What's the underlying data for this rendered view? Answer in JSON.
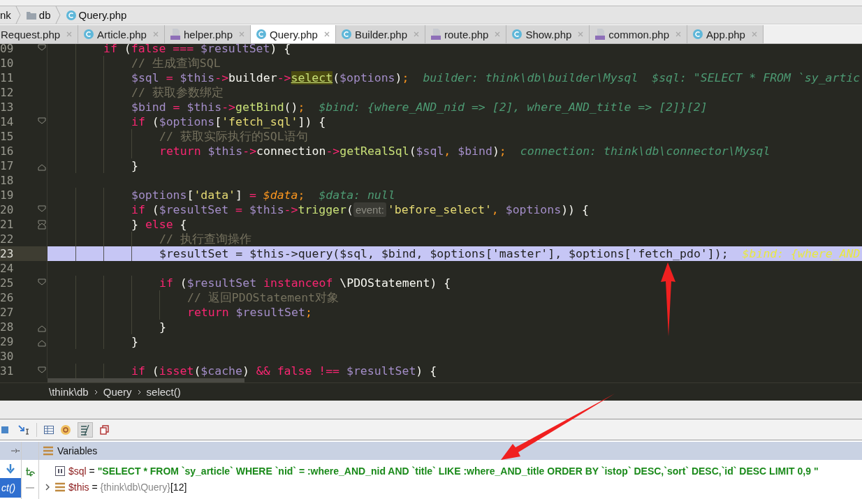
{
  "path_bar": [
    {
      "kind": "text",
      "label": "nk"
    },
    {
      "kind": "folder",
      "label": "db"
    },
    {
      "kind": "class",
      "label": "Query.php"
    }
  ],
  "tabs": [
    {
      "label": "Request.php",
      "kind": "plain",
      "selected": false
    },
    {
      "label": "Article.php",
      "kind": "class",
      "selected": false
    },
    {
      "label": "helper.php",
      "kind": "php",
      "selected": false
    },
    {
      "label": "Query.php",
      "kind": "class",
      "selected": true
    },
    {
      "label": "Builder.php",
      "kind": "class",
      "selected": false
    },
    {
      "label": "route.php",
      "kind": "php",
      "selected": false
    },
    {
      "label": "Show.php",
      "kind": "class",
      "selected": false
    },
    {
      "label": "common.php",
      "kind": "php",
      "selected": false
    },
    {
      "label": "App.php",
      "kind": "class",
      "selected": false
    }
  ],
  "lines": [
    {
      "number": "09",
      "fold_start": true,
      "fold_end": false,
      "current": false,
      "tokens": [
        {
          "kind": "kw",
          "text": "if"
        },
        {
          "kind": "txt",
          "text": " ("
        },
        {
          "kind": "kw",
          "text": "false === "
        },
        {
          "kind": "var",
          "text": "$resultSet"
        },
        {
          "kind": "txt",
          "text": ") {"
        }
      ],
      "children": [
        {
          "number": "10",
          "fold_start": false,
          "fold_end": false,
          "current": false,
          "tokens": [
            {
              "kind": "cmt",
              "text": "// 生成查询SQL"
            }
          ]
        },
        {
          "number": "11",
          "fold_start": false,
          "fold_end": false,
          "current": false,
          "tokens": [
            {
              "kind": "var",
              "text": "$sql"
            },
            {
              "kind": "op",
              "text": " = "
            },
            {
              "kind": "var",
              "text": "$this"
            },
            {
              "kind": "op",
              "text": "->"
            },
            {
              "kind": "txt",
              "text": "builder"
            },
            {
              "kind": "op",
              "text": "->"
            },
            {
              "kind": "usage",
              "text": "select"
            },
            {
              "kind": "txt",
              "text": "("
            },
            {
              "kind": "var",
              "text": "$options"
            },
            {
              "kind": "txt",
              "text": ")"
            },
            {
              "kind": "semi",
              "text": ";"
            },
            {
              "kind": "hint",
              "text": "builder: think\\db\\builder\\Mysql  $sql: \"SELECT * FROM `sy_artic"
            }
          ]
        },
        {
          "number": "12",
          "fold_start": false,
          "fold_end": false,
          "current": false,
          "tokens": [
            {
              "kind": "cmt",
              "text": "// 获取参数绑定"
            }
          ]
        },
        {
          "number": "13",
          "fold_start": false,
          "fold_end": false,
          "current": false,
          "tokens": [
            {
              "kind": "var",
              "text": "$bind"
            },
            {
              "kind": "op",
              "text": " = "
            },
            {
              "kind": "var",
              "text": "$this"
            },
            {
              "kind": "op",
              "text": "->"
            },
            {
              "kind": "fn",
              "text": "getBind"
            },
            {
              "kind": "txt",
              "text": "()"
            },
            {
              "kind": "semi",
              "text": ";"
            },
            {
              "kind": "hint",
              "text": "$bind: {where_AND_nid => [2], where_AND_title => [2]}[2]"
            }
          ]
        },
        {
          "number": "14",
          "fold_start": true,
          "fold_end": false,
          "current": false,
          "tokens": [
            {
              "kind": "kw",
              "text": "if"
            },
            {
              "kind": "txt",
              "text": " ("
            },
            {
              "kind": "var",
              "text": "$options"
            },
            {
              "kind": "txt",
              "text": "["
            },
            {
              "kind": "str",
              "text": "'fetch_sql'"
            },
            {
              "kind": "txt",
              "text": "]) {"
            }
          ],
          "children": [
            {
              "number": "15",
              "fold_start": false,
              "fold_end": false,
              "current": false,
              "tokens": [
                {
                  "kind": "cmt",
                  "text": "// 获取实际执行的SQL语句"
                }
              ]
            },
            {
              "number": "16",
              "fold_start": false,
              "fold_end": false,
              "current": false,
              "tokens": [
                {
                  "kind": "kw",
                  "text": "return "
                },
                {
                  "kind": "var",
                  "text": "$this"
                },
                {
                  "kind": "op",
                  "text": "->"
                },
                {
                  "kind": "txt",
                  "text": "connection"
                },
                {
                  "kind": "op",
                  "text": "->"
                },
                {
                  "kind": "fn",
                  "text": "getRealSql"
                },
                {
                  "kind": "txt",
                  "text": "("
                },
                {
                  "kind": "var",
                  "text": "$sql"
                },
                {
                  "kind": "semi",
                  "text": ", "
                },
                {
                  "kind": "var",
                  "text": "$bind"
                },
                {
                  "kind": "txt",
                  "text": ")"
                },
                {
                  "kind": "semi",
                  "text": ";"
                },
                {
                  "kind": "hint",
                  "text": "connection: think\\db\\connector\\Mysql"
                }
              ]
            }
          ]
        },
        {
          "number": "17",
          "fold_start": false,
          "fold_end": true,
          "current": false,
          "tokens": [
            {
              "kind": "txt",
              "text": "}"
            }
          ]
        },
        {
          "number": "18",
          "fold_start": false,
          "fold_end": false,
          "current": false
        },
        {
          "number": "19",
          "fold_start": false,
          "fold_end": false,
          "current": false,
          "tokens": [
            {
              "kind": "var",
              "text": "$options"
            },
            {
              "kind": "txt",
              "text": "["
            },
            {
              "kind": "str",
              "text": "'data'"
            },
            {
              "kind": "txt",
              "text": "]"
            },
            {
              "kind": "op",
              "text": " = "
            },
            {
              "kind": "param",
              "text": "$data"
            },
            {
              "kind": "semi",
              "text": ";"
            },
            {
              "kind": "hint",
              "text": "$data: null"
            }
          ]
        },
        {
          "number": "20",
          "fold_start": true,
          "fold_end": false,
          "current": false,
          "tokens": [
            {
              "kind": "kw",
              "text": "if"
            },
            {
              "kind": "txt",
              "text": " ("
            },
            {
              "kind": "var",
              "text": "$resultSet"
            },
            {
              "kind": "op",
              "text": " = "
            },
            {
              "kind": "var",
              "text": "$this"
            },
            {
              "kind": "op",
              "text": "->"
            },
            {
              "kind": "fn",
              "text": "trigger"
            },
            {
              "kind": "txt",
              "text": "("
            },
            {
              "kind": "label",
              "text": "event:"
            },
            {
              "kind": "str",
              "text": "'before_select'"
            },
            {
              "kind": "semi",
              "text": ", "
            },
            {
              "kind": "var",
              "text": "$options"
            },
            {
              "kind": "txt",
              "text": ")) {"
            }
          ]
        },
        {
          "number": "21",
          "fold_start": true,
          "fold_end": true,
          "current": false,
          "tokens": [
            {
              "kind": "txt",
              "text": "} "
            },
            {
              "kind": "kw",
              "text": "else"
            },
            {
              "kind": "txt",
              "text": " {"
            }
          ],
          "children": [
            {
              "number": "22",
              "fold_start": false,
              "fold_end": false,
              "current": false,
              "tokens": [
                {
                  "kind": "cmt",
                  "text": "// 执行查询操作"
                }
              ]
            },
            {
              "number": "23",
              "fold_start": false,
              "fold_end": false,
              "current": true,
              "tokens": [
                {
                  "kind": "txt",
                  "text": "$resultSet = $this->query($sql, $bind, $options['master'], $options['fetch_pdo']);"
                },
                {
                  "kind": "hint",
                  "text": "$bind: {where_AND"
                }
              ]
            },
            {
              "number": "24",
              "fold_start": false,
              "fold_end": false,
              "current": false
            },
            {
              "number": "25",
              "fold_start": true,
              "fold_end": false,
              "current": false,
              "tokens": [
                {
                  "kind": "kw",
                  "text": "if"
                },
                {
                  "kind": "txt",
                  "text": " ("
                },
                {
                  "kind": "var",
                  "text": "$resultSet"
                },
                {
                  "kind": "kw",
                  "text": " instanceof"
                },
                {
                  "kind": "txt",
                  "text": " \\PDOStatement) {"
                }
              ],
              "children": [
                {
                  "number": "26",
                  "fold_start": false,
                  "fold_end": false,
                  "current": false,
                  "tokens": [
                    {
                      "kind": "cmt",
                      "text": "// 返回PDOStatement对象"
                    }
                  ]
                },
                {
                  "number": "27",
                  "fold_start": false,
                  "fold_end": false,
                  "current": false,
                  "tokens": [
                    {
                      "kind": "kw",
                      "text": "return "
                    },
                    {
                      "kind": "var",
                      "text": "$resultSet"
                    },
                    {
                      "kind": "semi",
                      "text": ";"
                    }
                  ]
                }
              ]
            },
            {
              "number": "28",
              "fold_start": false,
              "fold_end": true,
              "current": false,
              "tokens": [
                {
                  "kind": "txt",
                  "text": "}"
                }
              ]
            }
          ]
        },
        {
          "number": "29",
          "fold_start": false,
          "fold_end": true,
          "current": false,
          "tokens": [
            {
              "kind": "txt",
              "text": "}"
            }
          ]
        },
        {
          "number": "30",
          "fold_start": false,
          "fold_end": false,
          "current": false
        },
        {
          "number": "31",
          "fold_start": true,
          "fold_end": false,
          "current": false,
          "tokens": [
            {
              "kind": "kw",
              "text": "if"
            },
            {
              "kind": "txt",
              "text": " ("
            },
            {
              "kind": "kw",
              "text": "isset"
            },
            {
              "kind": "txt",
              "text": "("
            },
            {
              "kind": "var",
              "text": "$cache"
            },
            {
              "kind": "txt",
              "text": ") "
            },
            {
              "kind": "kw",
              "text": "&& false !== "
            },
            {
              "kind": "var",
              "text": "$resultSet"
            },
            {
              "kind": "txt",
              "text": ") {"
            }
          ]
        }
      ]
    }
  ],
  "breadcrumb": [
    "\\think\\db",
    "Query",
    "select()"
  ],
  "debugger": {
    "frame": {
      "label": "ct()",
      "selected": true
    },
    "variables_title": "Variables",
    "variables": [
      {
        "kind": "string",
        "name": "$sql",
        "operator": "=",
        "value": "\"SELECT * FROM `sy_article` WHERE  `nid` = :where_AND_nid  AND `title` LIKE :where_AND_title ORDER BY `istop` DESC,`sort` DESC,`id` DESC LIMIT 0,9 \""
      },
      {
        "kind": "object",
        "name": "$this",
        "operator": "=",
        "value": "{think\\db\\Query}",
        "count": "[12]"
      }
    ]
  }
}
